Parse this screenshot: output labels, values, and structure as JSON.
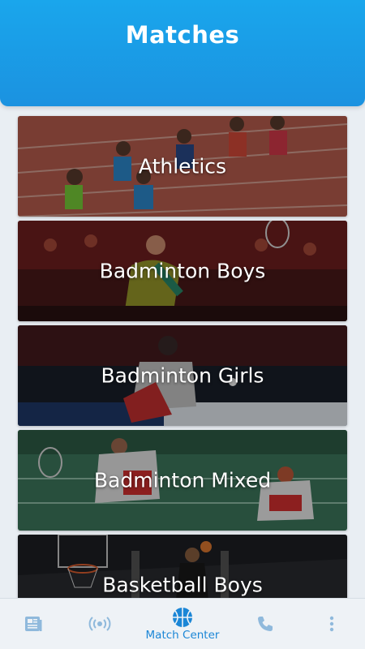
{
  "header": {
    "title": "Matches"
  },
  "cards": [
    {
      "label": "Athletics",
      "icon": "athletics-photo"
    },
    {
      "label": "Badminton Boys",
      "icon": "badminton-boys-photo"
    },
    {
      "label": "Badminton Girls",
      "icon": "badminton-girls-photo"
    },
    {
      "label": "Badminton Mixed",
      "icon": "badminton-mixed-photo"
    },
    {
      "label": "Basketball Boys",
      "icon": "basketball-boys-photo"
    }
  ],
  "bottom_nav": {
    "items": [
      {
        "icon": "news-icon"
      },
      {
        "icon": "live-broadcast-icon"
      },
      {
        "icon": "basketball-icon",
        "label": "Match Center",
        "active": true
      },
      {
        "icon": "phone-icon"
      },
      {
        "icon": "more-vertical-icon"
      }
    ],
    "active_color": "#1b86d6",
    "inactive_color": "#8fb9dc"
  },
  "colors": {
    "header": "#1a9de6",
    "background": "#e9eef3"
  }
}
